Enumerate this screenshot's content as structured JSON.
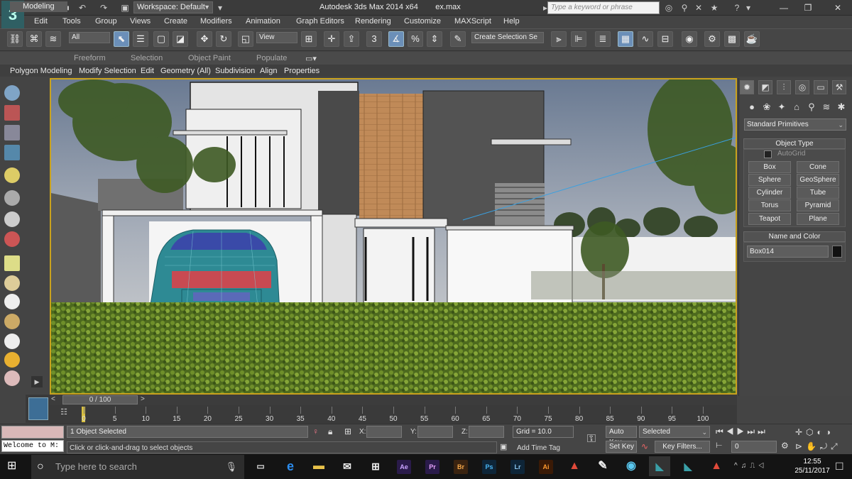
{
  "title_bar": {
    "workspace_label": "Workspace: Default",
    "app_title": "Autodesk 3ds Max  2014 x64",
    "file_name": "ex.max",
    "search_placeholder": "Type a keyword or phrase"
  },
  "menu": [
    "Edit",
    "Tools",
    "Group",
    "Views",
    "Create",
    "Modifiers",
    "Animation",
    "Graph Editors",
    "Rendering",
    "Customize",
    "MAXScript",
    "Help"
  ],
  "toolbar": {
    "selection_filter": "All",
    "ref_coord": "View",
    "named_selection": "Create Selection Se",
    "snap_number": "3",
    "percent_label": "%"
  },
  "ribbon": {
    "tabs": [
      "Modeling",
      "Freeform",
      "Selection",
      "Object Paint",
      "Populate"
    ],
    "panels": [
      "Polygon Modeling",
      "Modify Selection",
      "Edit",
      "Geometry (All)",
      "Subdivision",
      "Align",
      "Properties"
    ]
  },
  "command_panel": {
    "dropdown": "Standard Primitives",
    "object_type_title": "Object Type",
    "autogrid_label": "AutoGrid",
    "primitives": [
      "Box",
      "Cone",
      "Sphere",
      "GeoSphere",
      "Cylinder",
      "Tube",
      "Torus",
      "Pyramid",
      "Teapot",
      "Plane"
    ],
    "name_color_title": "Name and Color",
    "object_name": "Box014",
    "object_color": "#111111"
  },
  "timeline": {
    "frame_display": "0 / 100",
    "ticks": [
      "0",
      "5",
      "10",
      "15",
      "20",
      "25",
      "30",
      "35",
      "40",
      "45",
      "50",
      "55",
      "60",
      "65",
      "70",
      "75",
      "80",
      "85",
      "90",
      "95",
      "100"
    ]
  },
  "status_bar": {
    "selected_count": "1 Object Selected",
    "prompt": "Click or click-and-drag to select objects",
    "x_label": "X:",
    "y_label": "Y:",
    "z_label": "Z:",
    "grid": "Grid = 10.0",
    "add_time_tag": "Add Time Tag",
    "auto_key": "Auto Key",
    "set_key": "Set Key",
    "key_mode": "Selected",
    "key_filters": "Key Filters...",
    "current_frame": "0",
    "maxscript_listener": "Welcome to M:"
  },
  "taskbar": {
    "search_placeholder": "Type here to search",
    "apps": [
      "Ae",
      "Pr",
      "Br",
      "Ps",
      "Lr",
      "Ai"
    ],
    "time": "12:55",
    "date": "25/11/2017"
  },
  "colors": {
    "viewport_border": "#c9a21e",
    "accent_blue": "#6b8fb8"
  }
}
